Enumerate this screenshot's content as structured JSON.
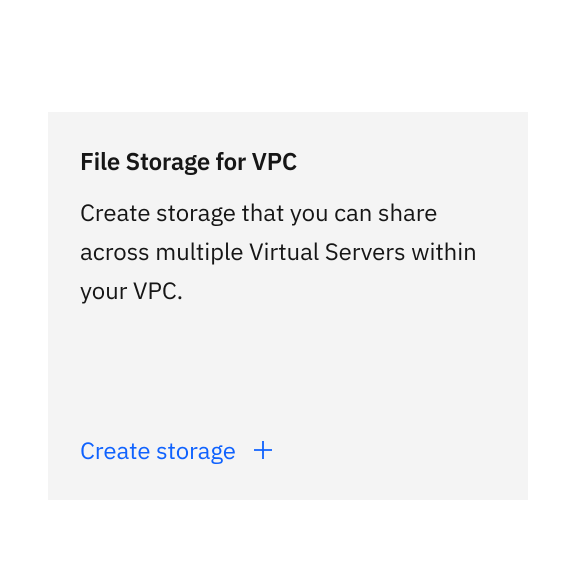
{
  "card": {
    "title": "File Storage for VPC",
    "description": "Create storage that you can share across multiple Virtual Servers within your VPC.",
    "action_label": "Create storage"
  },
  "colors": {
    "card_bg": "#f4f4f4",
    "text_primary": "#161616",
    "link": "#0f62fe"
  }
}
